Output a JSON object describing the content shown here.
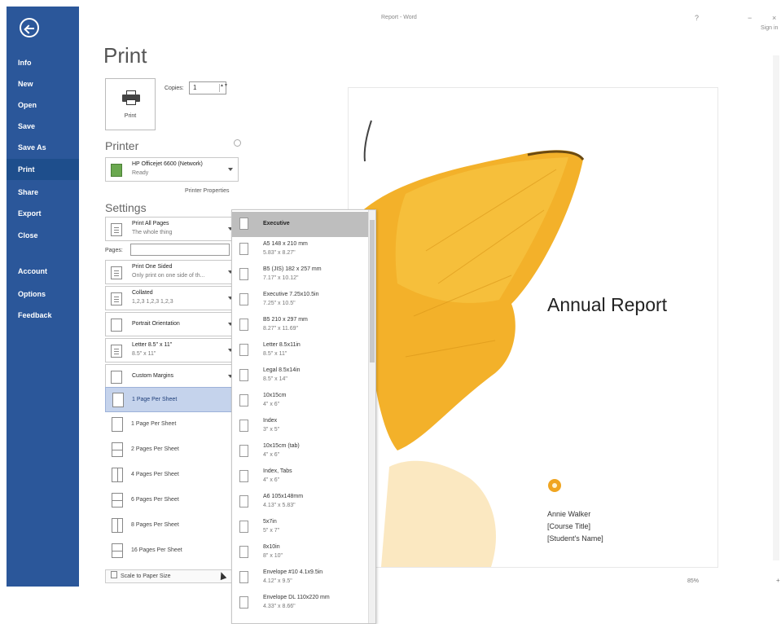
{
  "window": {
    "title": "Report - Word",
    "help_label": "?",
    "minimize_label": "−",
    "close_label": "×",
    "sign_in": "Sign in"
  },
  "nav": {
    "items": [
      "Info",
      "New",
      "Open",
      "Save",
      "Save As",
      "Print",
      "Share",
      "Export",
      "Close",
      "Account",
      "Options",
      "Feedback"
    ],
    "active_index": 5
  },
  "print": {
    "title": "Print",
    "print_button": "Print",
    "copies_label": "Copies:",
    "copies_value": "1",
    "spin": "▲▼"
  },
  "printer": {
    "section_title": "Printer",
    "name": "HP Officejet 6600 (Network)",
    "status": "Ready",
    "properties_link": "Printer Properties"
  },
  "settings": {
    "section_title": "Settings",
    "print_what": {
      "l1": "Print All Pages",
      "l2": "The whole thing"
    },
    "pages_label": "Pages:",
    "sides": {
      "l1": "Print One Sided",
      "l2": "Only print on one side of th..."
    },
    "collated": {
      "l1": "Collated",
      "l2": "1,2,3  1,2,3  1,2,3"
    },
    "orientation": {
      "l1": "Portrait Orientation",
      "l2": ""
    },
    "paper": {
      "l1": "Letter 8.5\" x 11\"",
      "l2": "8.5\" x 11\""
    },
    "margins": {
      "l1": "Custom Margins",
      "l2": ""
    },
    "pages_per_sheet": [
      {
        "label": "1 Page Per Sheet",
        "selected": true
      },
      {
        "label": "1 Page Per Sheet",
        "selected": false
      },
      {
        "label": "2 Pages Per Sheet",
        "selected": false
      },
      {
        "label": "4 Pages Per Sheet",
        "selected": false
      },
      {
        "label": "6 Pages Per Sheet",
        "selected": false
      },
      {
        "label": "8 Pages Per Sheet",
        "selected": false
      },
      {
        "label": "16 Pages Per Sheet",
        "selected": false
      }
    ],
    "scale_button": "Scale to Paper Size"
  },
  "paper_menu": {
    "items": [
      {
        "name": "Executive",
        "dims": "",
        "selected": true
      },
      {
        "name": "A5 148 x 210 mm",
        "dims": "5.83\" x 8.27\""
      },
      {
        "name": "B5 (JIS) 182 x 257 mm",
        "dims": "7.17\" x 10.12\""
      },
      {
        "name": "Executive 7.25x10.5in",
        "dims": "7.25\" x 10.5\""
      },
      {
        "name": "B5 210 x 297 mm",
        "dims": "8.27\" x 11.69\""
      },
      {
        "name": "Letter 8.5x11in",
        "dims": "8.5\" x 11\""
      },
      {
        "name": "Legal 8.5x14in",
        "dims": "8.5\" x 14\""
      },
      {
        "name": "10x15cm",
        "dims": "4\" x 6\""
      },
      {
        "name": "Index",
        "dims": "3\" x 5\""
      },
      {
        "name": "10x15cm (tab)",
        "dims": "4\" x 6\""
      },
      {
        "name": "Index, Tabs",
        "dims": "4\" x 6\""
      },
      {
        "name": "A6 105x148mm",
        "dims": "4.13\" x 5.83\""
      },
      {
        "name": "5x7in",
        "dims": "5\" x 7\""
      },
      {
        "name": "8x10in",
        "dims": "8\" x 10\""
      },
      {
        "name": "Envelope #10 4.1x9.5in",
        "dims": "4.12\" x 9.5\""
      },
      {
        "name": "Envelope DL 110x220 mm",
        "dims": "4.33\" x 8.66\""
      }
    ]
  },
  "preview": {
    "title": "Annual Report",
    "author_lines": [
      "Annie Walker",
      "[Course Title]",
      "[Student's Name]"
    ],
    "zoom": "85%",
    "zoom_plus": "+",
    "accent": "#f0a521",
    "butterfly": "#f2b423"
  }
}
